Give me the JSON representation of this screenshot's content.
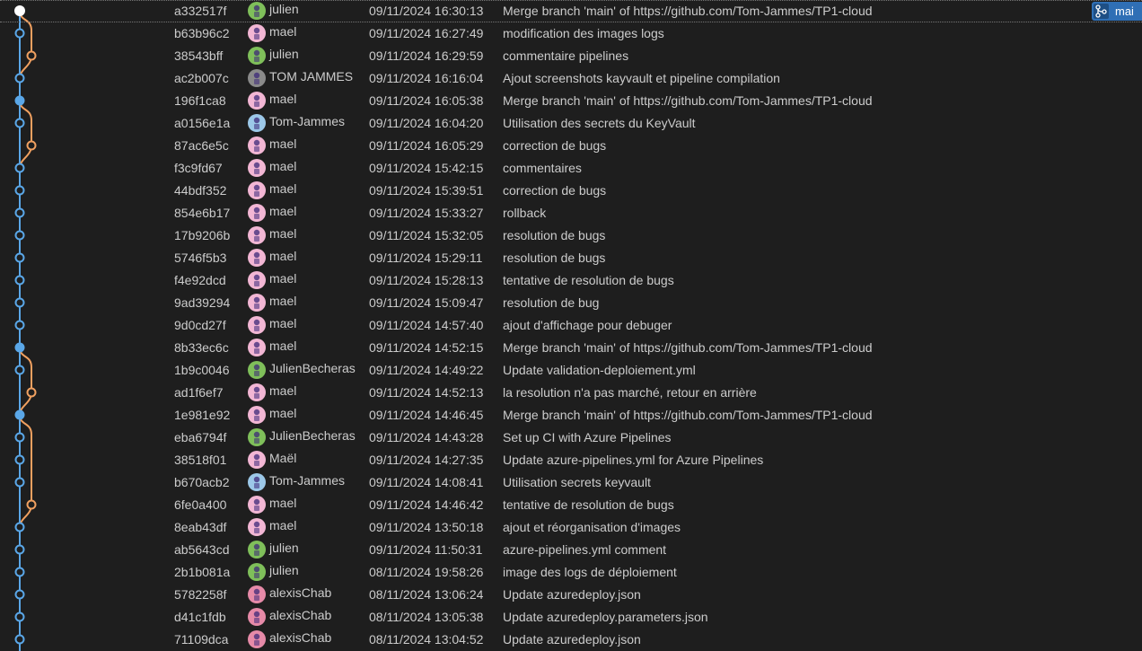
{
  "colors": {
    "main_lane": "#5aa7e8",
    "side_lane": "#f0a060",
    "head_node": "#ffffff",
    "text": "#cccccc",
    "branch_tag": "#2f6fb5",
    "avatar_green": "#7fbf5a",
    "avatar_pink": "#f2b6d4",
    "avatar_gray": "#8a8a8a",
    "avatar_blue": "#9cc8e8",
    "avatar_rose": "#e68aa8"
  },
  "branch_tag": {
    "label": "mai",
    "icon": "git-branch-icon"
  },
  "commits": [
    {
      "hash": "a332517f",
      "author": "julien",
      "date": "09/11/2024 16:30:13",
      "message": "Merge branch 'main' of https://github.com/Tom-Jammes/TP1-cloud",
      "avatar": "green",
      "node": "head",
      "selected": true
    },
    {
      "hash": "b63b96c2",
      "author": "mael",
      "date": "09/11/2024 16:27:49",
      "message": "modification des images logs",
      "avatar": "pink",
      "node": "main"
    },
    {
      "hash": "38543bff",
      "author": "julien",
      "date": "09/11/2024 16:29:59",
      "message": "commentaire pipelines",
      "avatar": "green",
      "node": "side"
    },
    {
      "hash": "ac2b007c",
      "author": "TOM JAMMES",
      "date": "09/11/2024 16:16:04",
      "message": "Ajout screenshots kayvault et pipeline compilation",
      "avatar": "gray",
      "node": "main"
    },
    {
      "hash": "196f1ca8",
      "author": "mael",
      "date": "09/11/2024 16:05:38",
      "message": "Merge branch 'main' of https://github.com/Tom-Jammes/TP1-cloud",
      "avatar": "pink",
      "node": "merge"
    },
    {
      "hash": "a0156e1a",
      "author": "Tom-Jammes",
      "date": "09/11/2024 16:04:20",
      "message": "Utilisation des secrets du KeyVault",
      "avatar": "blue",
      "node": "main"
    },
    {
      "hash": "87ac6e5c",
      "author": "mael",
      "date": "09/11/2024 16:05:29",
      "message": "correction de bugs",
      "avatar": "pink",
      "node": "side"
    },
    {
      "hash": "f3c9fd67",
      "author": "mael",
      "date": "09/11/2024 15:42:15",
      "message": "commentaires",
      "avatar": "pink",
      "node": "main"
    },
    {
      "hash": "44bdf352",
      "author": "mael",
      "date": "09/11/2024 15:39:51",
      "message": "correction de bugs",
      "avatar": "pink",
      "node": "main"
    },
    {
      "hash": "854e6b17",
      "author": "mael",
      "date": "09/11/2024 15:33:27",
      "message": "rollback",
      "avatar": "pink",
      "node": "main"
    },
    {
      "hash": "17b9206b",
      "author": "mael",
      "date": "09/11/2024 15:32:05",
      "message": "resolution de bugs",
      "avatar": "pink",
      "node": "main"
    },
    {
      "hash": "5746f5b3",
      "author": "mael",
      "date": "09/11/2024 15:29:11",
      "message": "resolution de bugs",
      "avatar": "pink",
      "node": "main"
    },
    {
      "hash": "f4e92dcd",
      "author": "mael",
      "date": "09/11/2024 15:28:13",
      "message": "tentative de resolution de bugs",
      "avatar": "pink",
      "node": "main"
    },
    {
      "hash": "9ad39294",
      "author": "mael",
      "date": "09/11/2024 15:09:47",
      "message": "resolution de bug",
      "avatar": "pink",
      "node": "main"
    },
    {
      "hash": "9d0cd27f",
      "author": "mael",
      "date": "09/11/2024 14:57:40",
      "message": "ajout d'affichage pour debuger",
      "avatar": "pink",
      "node": "main"
    },
    {
      "hash": "8b33ec6c",
      "author": "mael",
      "date": "09/11/2024 14:52:15",
      "message": "Merge branch 'main' of https://github.com/Tom-Jammes/TP1-cloud",
      "avatar": "pink",
      "node": "merge"
    },
    {
      "hash": "1b9c0046",
      "author": "JulienBecheras",
      "date": "09/11/2024 14:49:22",
      "message": "Update validation-deploiement.yml",
      "avatar": "green",
      "node": "main"
    },
    {
      "hash": "ad1f6ef7",
      "author": "mael",
      "date": "09/11/2024 14:52:13",
      "message": "la resolution n'a pas marché, retour en arrière",
      "avatar": "pink",
      "node": "side"
    },
    {
      "hash": "1e981e92",
      "author": "mael",
      "date": "09/11/2024 14:46:45",
      "message": "Merge branch 'main' of https://github.com/Tom-Jammes/TP1-cloud",
      "avatar": "pink",
      "node": "merge"
    },
    {
      "hash": "eba6794f",
      "author": "JulienBecheras",
      "date": "09/11/2024 14:43:28",
      "message": "Set up CI with Azure Pipelines",
      "avatar": "green",
      "node": "main"
    },
    {
      "hash": "38518f01",
      "author": "Maël",
      "date": "09/11/2024 14:27:35",
      "message": "Update azure-pipelines.yml for Azure Pipelines",
      "avatar": "pink",
      "node": "main"
    },
    {
      "hash": "b670acb2",
      "author": "Tom-Jammes",
      "date": "09/11/2024 14:08:41",
      "message": "Utilisation secrets keyvault",
      "avatar": "blue",
      "node": "main"
    },
    {
      "hash": "6fe0a400",
      "author": "mael",
      "date": "09/11/2024 14:46:42",
      "message": "tentative de resolution de bugs",
      "avatar": "pink",
      "node": "side"
    },
    {
      "hash": "8eab43df",
      "author": "mael",
      "date": "09/11/2024 13:50:18",
      "message": "ajout et réorganisation d'images",
      "avatar": "pink",
      "node": "main"
    },
    {
      "hash": "ab5643cd",
      "author": "julien",
      "date": "09/11/2024 11:50:31",
      "message": "azure-pipelines.yml comment",
      "avatar": "green",
      "node": "main"
    },
    {
      "hash": "2b1b081a",
      "author": "julien",
      "date": "08/11/2024 19:58:26",
      "message": "image des logs de déploiement",
      "avatar": "green",
      "node": "main"
    },
    {
      "hash": "5782258f",
      "author": "alexisChab",
      "date": "08/11/2024 13:06:24",
      "message": "Update azuredeploy.json",
      "avatar": "rose",
      "node": "main"
    },
    {
      "hash": "d41c1fdb",
      "author": "alexisChab",
      "date": "08/11/2024 13:05:38",
      "message": "Update azuredeploy.parameters.json",
      "avatar": "rose",
      "node": "main"
    },
    {
      "hash": "71109dca",
      "author": "alexisChab",
      "date": "08/11/2024 13:04:52",
      "message": "Update azuredeploy.json",
      "avatar": "rose",
      "node": "main"
    }
  ]
}
